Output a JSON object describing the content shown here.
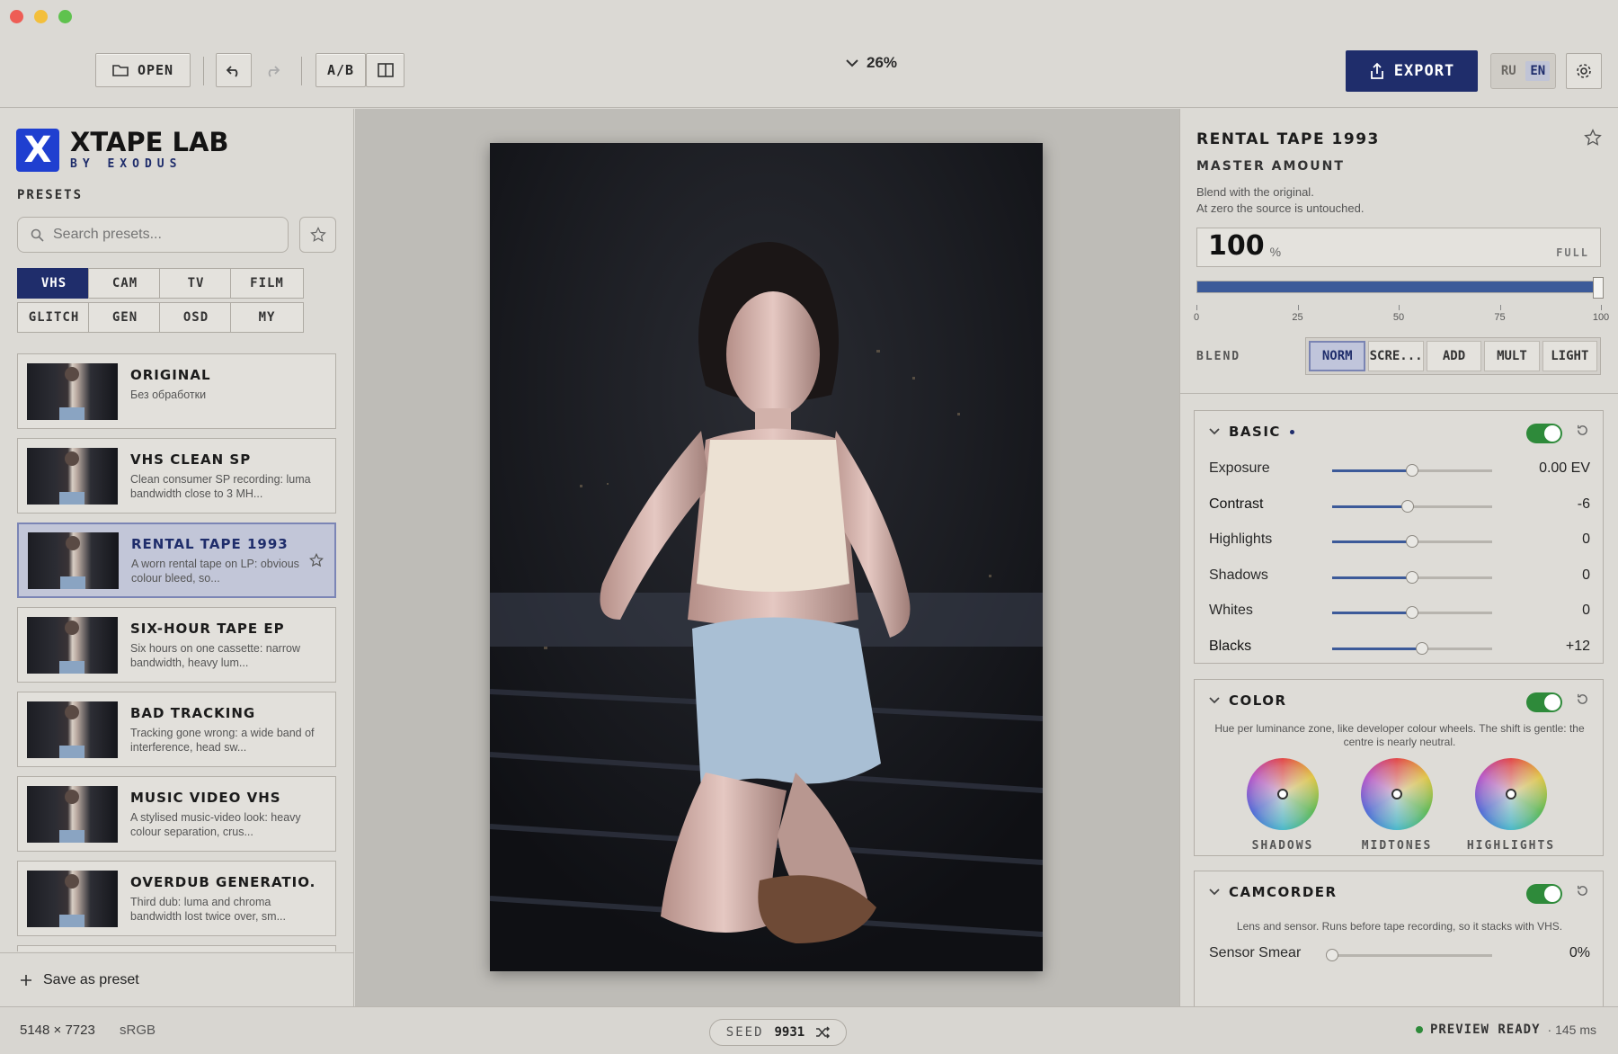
{
  "toolbar": {
    "open_label": "OPEN",
    "ab_label": "A/B",
    "zoom": "26%",
    "export_label": "EXPORT",
    "lang_ru": "RU",
    "lang_en": "EN"
  },
  "brand": {
    "name": "XTAPE LAB",
    "sub": "BY EXODUS"
  },
  "presets": {
    "heading": "PRESETS",
    "search_placeholder": "Search presets...",
    "categories": [
      "VHS",
      "CAM",
      "TV",
      "FILM",
      "GLITCH",
      "GEN",
      "OSD",
      "MY"
    ],
    "selected_category": "VHS",
    "items": [
      {
        "name": "ORIGINAL",
        "desc": "Без обработки"
      },
      {
        "name": "VHS CLEAN SP",
        "desc": "Clean consumer SP recording: luma bandwidth close to 3 MH..."
      },
      {
        "name": "RENTAL TAPE 1993",
        "desc": "A worn rental tape on LP: obvious colour bleed, so..."
      },
      {
        "name": "SIX-HOUR TAPE EP",
        "desc": "Six hours on one cassette: narrow bandwidth, heavy lum..."
      },
      {
        "name": "BAD TRACKING",
        "desc": "Tracking gone wrong: a wide band of interference, head sw..."
      },
      {
        "name": "MUSIC VIDEO VHS",
        "desc": "A stylised music-video look: heavy colour separation, crus..."
      },
      {
        "name": "OVERDUB GENERATIO...",
        "desc": "Third dub: luma and chroma bandwidth lost twice over, sm..."
      }
    ],
    "selected_index": 2,
    "save_label": "Save as preset"
  },
  "inspector": {
    "title": "RENTAL TAPE 1993",
    "master_label": "MASTER AMOUNT",
    "master_desc_1": "Blend with the original.",
    "master_desc_2": "At zero the source is untouched.",
    "amount_value": "100",
    "amount_unit": "%",
    "amount_full": "FULL",
    "amount_fraction": 1.0,
    "ticks": [
      "0",
      "25",
      "50",
      "75",
      "100"
    ],
    "blend_label": "BLEND",
    "blend_modes": [
      "NORM",
      "SCRE...",
      "ADD",
      "MULT",
      "LIGHT"
    ],
    "blend_selected": "NORM"
  },
  "basic": {
    "title": "BASIC",
    "enabled": true,
    "sliders": [
      {
        "label": "Exposure",
        "value": "0.00 EV",
        "level": 0.5
      },
      {
        "label": "Contrast",
        "value": "-6",
        "level": 0.47
      },
      {
        "label": "Highlights",
        "value": "0",
        "level": 0.5
      },
      {
        "label": "Shadows",
        "value": "0",
        "level": 0.5
      },
      {
        "label": "Whites",
        "value": "0",
        "level": 0.5
      },
      {
        "label": "Blacks",
        "value": "+12",
        "level": 0.56
      }
    ]
  },
  "color": {
    "title": "COLOR",
    "enabled": true,
    "desc": "Hue per luminance zone, like developer colour wheels. The shift is gentle: the centre is nearly neutral.",
    "wheels": [
      "SHADOWS",
      "MIDTONES",
      "HIGHLIGHTS"
    ]
  },
  "camcorder": {
    "title": "CAMCORDER",
    "enabled": true,
    "desc": "Lens and sensor. Runs before tape recording, so it stacks with VHS.",
    "sensor_label": "Sensor Smear",
    "sensor_value": "0%",
    "sensor_level": 0.0
  },
  "status": {
    "dimensions": "5148 × 7723",
    "colorspace": "sRGB",
    "seed_label": "SEED",
    "seed_value": "9931",
    "ready": "PREVIEW READY",
    "timing": "· 145 ms"
  },
  "colors": {
    "accent": "#1f2d6b",
    "toggle_on": "#2e8a3a",
    "slider_fill": "#3c5a99"
  }
}
